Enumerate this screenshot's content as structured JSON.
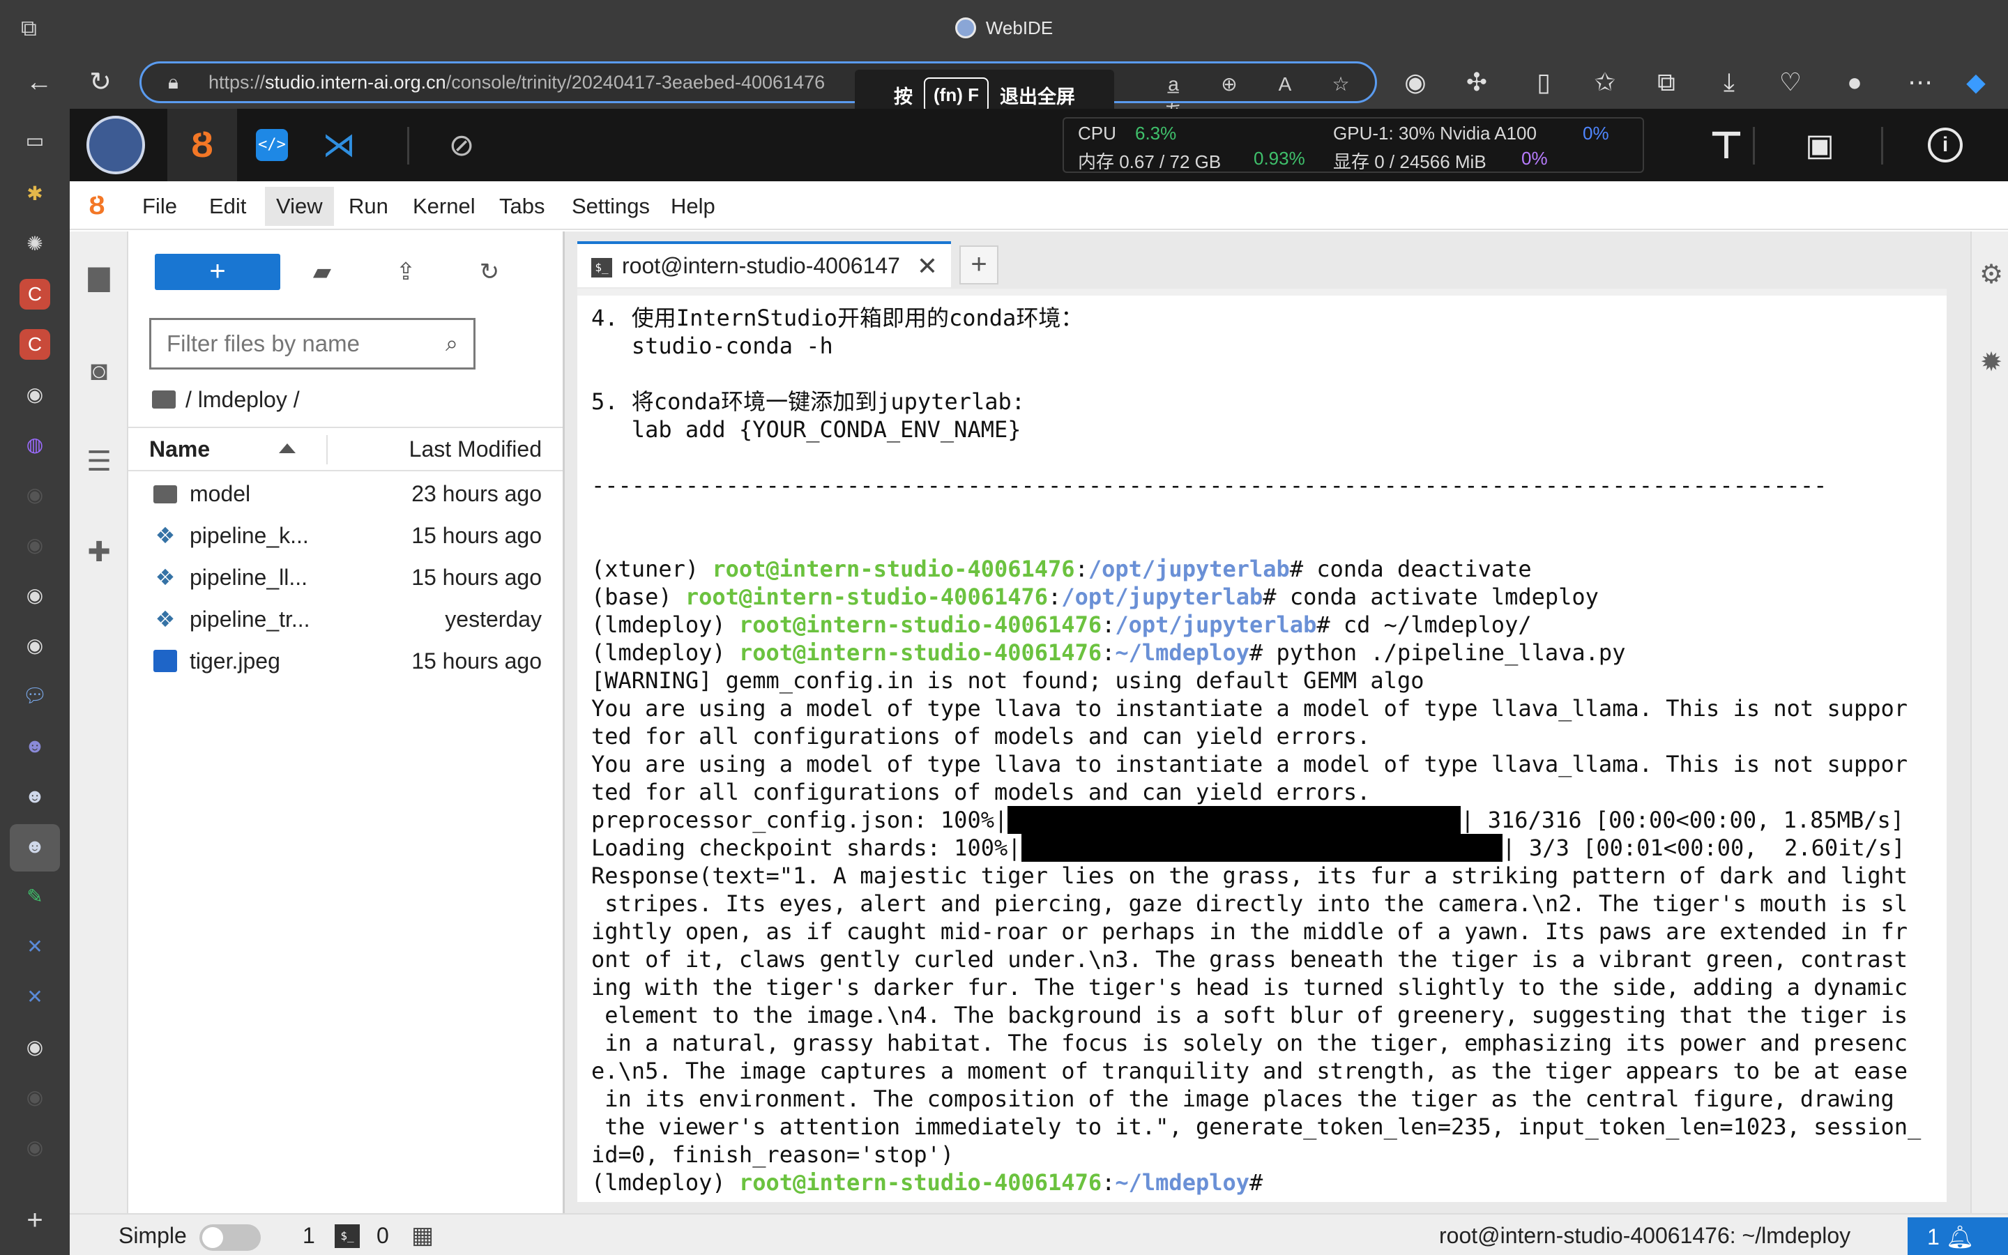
{
  "browser": {
    "window_title": "WebIDE",
    "url_prefix": "https://",
    "url_host": "studio.intern-ai.org.cn",
    "url_path": "/console/trinity/20240417-3eaebed-40061476",
    "fullscreen_hint": {
      "press": "按",
      "key": "(fn) F",
      "action": "退出全屏"
    }
  },
  "ide_header": {
    "cpu_label": "CPU",
    "cpu_value": "6.3%",
    "mem_label": "内存 0.67 / 72 GB",
    "mem_value": "0.93%",
    "gpu_label": "GPU-1: 30% Nvidia A100",
    "gpu_value": "0%",
    "vram_label": "显存 0 / 24566 MiB",
    "vram_value": "0%"
  },
  "menubar": {
    "items": [
      "File",
      "Edit",
      "View",
      "Run",
      "Kernel",
      "Tabs",
      "Settings",
      "Help"
    ],
    "active": "View"
  },
  "filebrowser": {
    "new_label": "+",
    "filter_placeholder": "Filter files by name",
    "breadcrumb": "/ lmdeploy /",
    "col_name": "Name",
    "col_modified": "Last Modified",
    "files": [
      {
        "name": "model",
        "modified": "23 hours ago",
        "type": "folder"
      },
      {
        "name": "pipeline_k...",
        "modified": "15 hours ago",
        "type": "python"
      },
      {
        "name": "pipeline_ll...",
        "modified": "15 hours ago",
        "type": "python"
      },
      {
        "name": "pipeline_tr...",
        "modified": "yesterday",
        "type": "python"
      },
      {
        "name": "tiger.jpeg",
        "modified": "15 hours ago",
        "type": "image"
      }
    ]
  },
  "terminal_tab": {
    "icon": "$_",
    "label": "root@intern-studio-40061476",
    "add_label": "+"
  },
  "terminal": {
    "l1": "4. 使用InternStudio开箱即用的conda环境：",
    "l2": "   studio-conda -h",
    "l3": "5. 将conda环境一键添加到jupyterlab:",
    "l4": "   lab add {YOUR_CONDA_ENV_NAME}",
    "rule": "--------------------------------------------------------------------------------------------",
    "p1_env": "(xtuner) ",
    "p1_host": "root@intern-studio-40061476",
    "p1_path": "/opt/jupyterlab",
    "p1_cmd": "# conda deactivate",
    "p2_env": "(base) ",
    "p2_host": "root@intern-studio-40061476",
    "p2_path": "/opt/jupyterlab",
    "p2_cmd": "# conda activate lmdeploy",
    "p3_env": "(lmdeploy) ",
    "p3_host": "root@intern-studio-40061476",
    "p3_path": "/opt/jupyterlab",
    "p3_cmd": "# cd ~/lmdeploy/",
    "p4_env": "(lmdeploy) ",
    "p4_host": "root@intern-studio-40061476",
    "p4_path": "~/lmdeploy",
    "p4_cmd": "# python ./pipeline_llava.py",
    "o1": "[WARNING] gemm_config.in is not found; using default GEMM algo",
    "o2": "You are using a model of type llava to instantiate a model of type llava_llama. This is not suppor",
    "o3": "ted for all configurations of models and can yield errors.",
    "o4": "You are using a model of type llava to instantiate a model of type llava_llama. This is not suppor",
    "o5": "ted for all configurations of models and can yield errors.",
    "pb1_label": "preprocessor_config.json: 100%|",
    "pb1_tail": "| 316/316 [00:00<00:00, 1.85MB/s]",
    "pb2_label": "Loading checkpoint shards: 100%|",
    "pb2_tail": "| 3/3 [00:01<00:00,  2.60it/s]",
    "r1": "Response(text=\"1. A majestic tiger lies on the grass, its fur a striking pattern of dark and light",
    "r2": " stripes. Its eyes, alert and piercing, gaze directly into the camera.\\n2. The tiger's mouth is sl",
    "r3": "ightly open, as if caught mid-roar or perhaps in the middle of a yawn. Its paws are extended in fr",
    "r4": "ont of it, claws gently curled under.\\n3. The grass beneath the tiger is a vibrant green, contrast",
    "r5": "ing with the tiger's darker fur. The tiger's head is turned slightly to the side, adding a dynamic",
    "r6": " element to the image.\\n4. The background is a soft blur of greenery, suggesting that the tiger is",
    "r7": " in a natural, grassy habitat. The focus is solely on the tiger, emphasizing its power and presenc",
    "r8": "e.\\n5. The image captures a moment of tranquility and strength, as the tiger appears to be at ease",
    "r9": " in its environment. The composition of the image places the tiger as the central figure, drawing",
    "r10": " the viewer's attention immediately to it.\", generate_token_len=235, input_token_len=1023, session_",
    "r11": "id=0, finish_reason='stop')",
    "p5_env": "(lmdeploy) ",
    "p5_host": "root@intern-studio-40061476",
    "p5_path": "~/lmdeploy",
    "p5_cmd": "#"
  },
  "statusbar": {
    "mode": "Simple",
    "count_terminals": "1",
    "count_kernels": "0",
    "context": "root@intern-studio-40061476: ~/lmdeploy",
    "notifications": "1"
  },
  "colors": {
    "accent": "#1976d2",
    "prompt_green": "#6bc23f",
    "prompt_blue": "#6a90d6",
    "jupyter_orange": "#f37726"
  }
}
